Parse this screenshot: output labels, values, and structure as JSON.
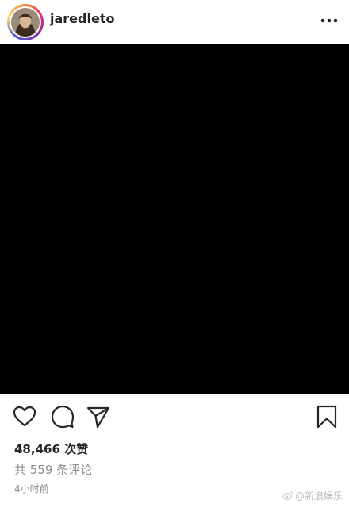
{
  "post": {
    "username": "jaredleto",
    "likes_text": "48,466 次赞",
    "comments_text": "共 559 条评论",
    "time_text": "4小时前"
  },
  "icons": {
    "more": "more-horizontal-icon",
    "like": "heart-outline-icon",
    "comment": "comment-bubble-icon",
    "share": "paper-plane-icon",
    "save": "bookmark-outline-icon"
  },
  "watermark": {
    "text": "@新浪娱乐"
  },
  "colors": {
    "text_primary": "#262626",
    "text_secondary": "#8e8e8e",
    "media_background": "#000000"
  }
}
